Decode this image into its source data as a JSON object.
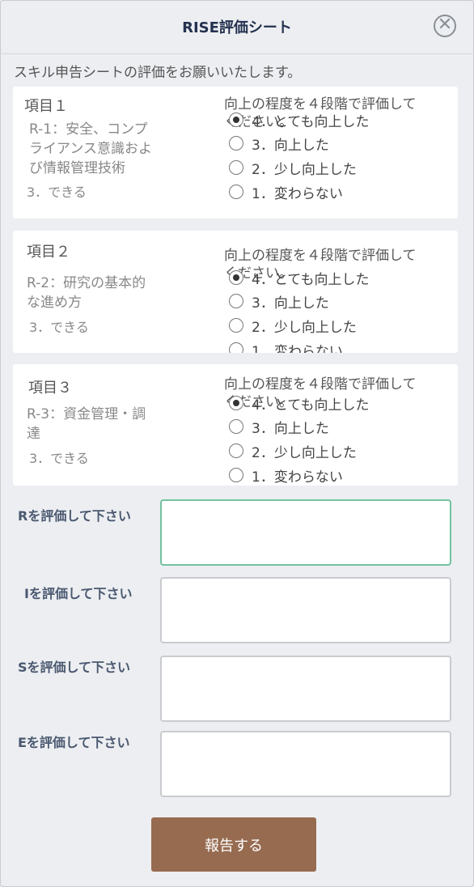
{
  "header": {
    "title": "RISE評価シート",
    "close_glyph": "✕"
  },
  "instruction": "スキル申告シートの評価をお願いいたします。",
  "question_text": "向上の程度を４段階で評価してください。",
  "options": [
    "4．とても向上した",
    "3．向上した",
    "2．少し向上した",
    "1．変わらない"
  ],
  "items": [
    {
      "title": "項目１",
      "desc": "R-1：安全、コンプライアンス意識および情報管理技術",
      "level": "3．できる",
      "selected": 0
    },
    {
      "title": "項目２",
      "desc": "R-2：研究の基本的な進め方",
      "level": "3．できる",
      "selected": 0
    },
    {
      "title": "項目３",
      "desc": "R-3：資金管理・調達",
      "level": "3．できる",
      "selected": 0
    }
  ],
  "fields": [
    {
      "label": "Rを評価して下さい",
      "value": ""
    },
    {
      "label": "Iを評価して下さい",
      "value": ""
    },
    {
      "label": "Sを評価して下さい",
      "value": ""
    },
    {
      "label": "Eを評価して下さい",
      "value": ""
    }
  ],
  "submit_label": "報告する",
  "colors": {
    "accent_focus": "#73c2a0",
    "submit_bg": "#976b50",
    "title_text": "#24314f"
  }
}
